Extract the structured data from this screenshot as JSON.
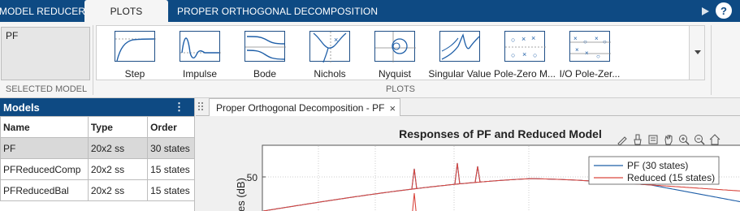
{
  "tabs": [
    {
      "label": "MODEL REDUCER",
      "active": false
    },
    {
      "label": "PLOTS",
      "active": true
    },
    {
      "label": "PROPER ORTHOGONAL DECOMPOSITION",
      "active": false
    }
  ],
  "help": {
    "label": "?"
  },
  "selected_model": {
    "value": "PF",
    "caption": "SELECTED MODEL"
  },
  "gallery": {
    "caption": "PLOTS",
    "items": [
      {
        "label": "Step",
        "icon": "step-response-icon"
      },
      {
        "label": "Impulse",
        "icon": "impulse-response-icon"
      },
      {
        "label": "Bode",
        "icon": "bode-plot-icon"
      },
      {
        "label": "Nichols",
        "icon": "nichols-plot-icon"
      },
      {
        "label": "Nyquist",
        "icon": "nyquist-plot-icon"
      },
      {
        "label": "Singular Value",
        "icon": "singular-value-icon"
      },
      {
        "label": "Pole-Zero M...",
        "icon": "pole-zero-map-icon"
      },
      {
        "label": "I/O Pole-Zer...",
        "icon": "io-pole-zero-icon"
      }
    ]
  },
  "models": {
    "title": "Models",
    "menu_glyph": "⋮",
    "columns": [
      "Name",
      "Type",
      "Order"
    ],
    "rows": [
      {
        "name": "PF",
        "type": "20x2 ss",
        "order": "30 states",
        "selected": true
      },
      {
        "name": "PFReducedComp",
        "type": "20x2 ss",
        "order": "15 states",
        "selected": false
      },
      {
        "name": "PFReducedBal",
        "type": "20x2 ss",
        "order": "15 states",
        "selected": false
      }
    ]
  },
  "document": {
    "tab_title": "Proper Orthogonal Decomposition - PF",
    "close_glyph": "×"
  },
  "axes_toolbar": [
    "edit-plot-icon",
    "brush-icon",
    "data-tips-icon",
    "pan-icon",
    "zoom-in-icon",
    "zoom-out-icon",
    "home-icon"
  ],
  "colors": {
    "accent": "#0e4a83",
    "series_full": "#1f5fa8",
    "series_reduced": "#d9473f"
  },
  "chart_data": {
    "type": "line",
    "title": "Responses of PF and Reduced Model",
    "ylabel": "es (dB)",
    "yticks": [
      50
    ],
    "legend": "top-right",
    "grid": true,
    "series": [
      {
        "name": "PF (30 states)",
        "color": "#1f5fa8"
      },
      {
        "name": "Reduced (15 states)",
        "color": "#d9473f"
      }
    ]
  }
}
